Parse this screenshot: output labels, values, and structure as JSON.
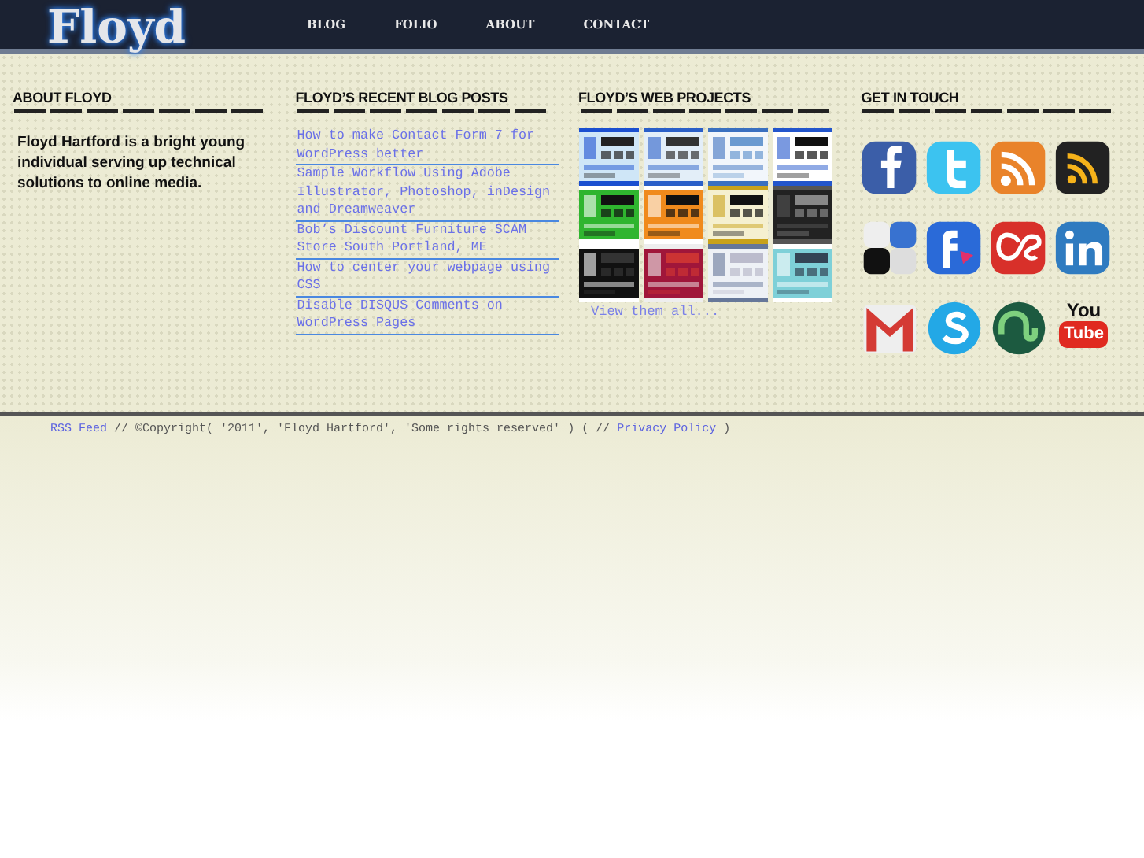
{
  "logo": "Floyd",
  "nav": [
    {
      "label": "BLOG"
    },
    {
      "label": "FOLIO"
    },
    {
      "label": "ABOUT"
    },
    {
      "label": "CONTACT"
    }
  ],
  "about": {
    "heading": "ABOUT FLOYD",
    "text": "Floyd Hartford is a bright young individual serving up technical solutions to online media."
  },
  "blog": {
    "heading": "FLOYD’S RECENT BLOG POSTS",
    "posts": [
      {
        "title": "How to make Contact Form 7 for WordPress better"
      },
      {
        "title": "Sample Workflow Using Adobe Illustrator, Photoshop, inDesign and Dreamweaver"
      },
      {
        "title": "Bob’s Discount Furniture SCAM Store South Portland, ME"
      },
      {
        "title": "How to center your webpage using CSS"
      },
      {
        "title": "Disable DISQUS Comments on WordPress Pages"
      }
    ]
  },
  "projects": {
    "heading": "FLOYD’S WEB PROJECTS",
    "more": "View them all..."
  },
  "contact": {
    "heading": "GET IN TOUCH",
    "icons": [
      {
        "kind": "facebook"
      },
      {
        "kind": "twitter"
      },
      {
        "kind": "rss"
      },
      {
        "kind": "rss-dark"
      },
      {
        "kind": "delicious"
      },
      {
        "kind": "friendfeed"
      },
      {
        "kind": "lastfm"
      },
      {
        "kind": "linkedin"
      },
      {
        "kind": "gmail"
      },
      {
        "kind": "skype"
      },
      {
        "kind": "stumbleupon"
      },
      {
        "kind": "youtube",
        "text": [
          "You",
          "Tube"
        ]
      }
    ]
  },
  "footer": {
    "rss_link": "RSS Feed",
    "middle": "// ©Copyright( '2011', 'Floyd Hartford', 'Some rights reserved' ) ( //",
    "privacy_link": "Privacy Policy",
    "end": ")"
  }
}
